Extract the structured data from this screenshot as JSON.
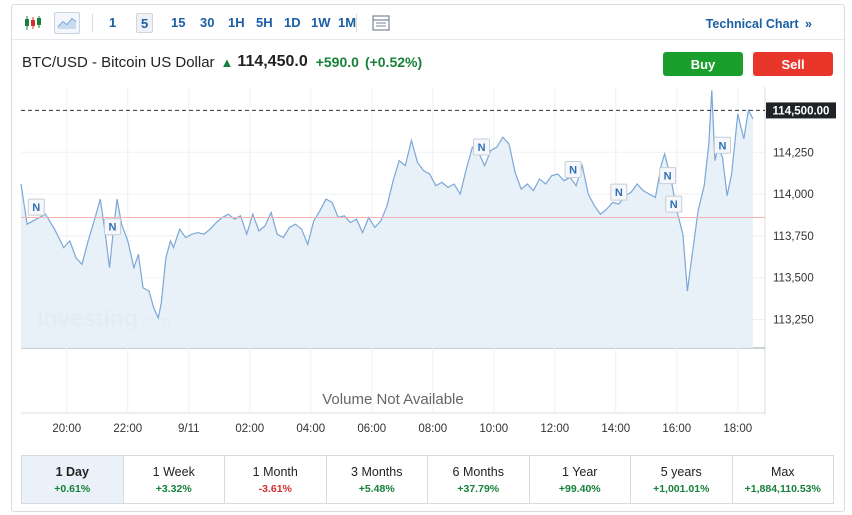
{
  "toolbar": {
    "candles_icon": "candlestick-icon",
    "area_icon": "area-chart-icon",
    "timeframes": [
      "1",
      "5",
      "15",
      "30",
      "1H",
      "5H",
      "1D",
      "1W",
      "1M"
    ],
    "active_timeframe": "5",
    "table_icon": "table-icon",
    "technical_link": "Technical Chart",
    "technical_chevron": "»"
  },
  "header": {
    "name": "BTC/USD - Bitcoin US Dollar",
    "price": "114,450.0",
    "change": "+590.0",
    "change_pct": "(+0.52%)"
  },
  "actions": {
    "buy": "Buy",
    "sell": "Sell"
  },
  "colors": {
    "up": "#16813a",
    "down": "#d32f2f",
    "buy": "#1a9e2c",
    "sell": "#e8362a",
    "line": "#7ca7d8",
    "fill": "#e6eef7",
    "link": "#1b5fa6"
  },
  "watermark": "Investing.com",
  "volume_text": "Volume Not Available",
  "chart_data": {
    "type": "area",
    "x_ticks": [
      "20:00",
      "22:00",
      "9/11",
      "02:00",
      "04:00",
      "06:00",
      "08:00",
      "10:00",
      "12:00",
      "14:00",
      "16:00",
      "18:00"
    ],
    "y_ticks": [
      "114,250",
      "114,000",
      "113,750",
      "113,500",
      "113,250"
    ],
    "y_tick_values": [
      114250,
      114000,
      113750,
      113500,
      113250
    ],
    "ylim": [
      113080,
      114640
    ],
    "current_price_label": "114,500.00",
    "current_price": 114500,
    "reference_line": 113860,
    "news_markers": [
      {
        "label": "N",
        "t": 0.5
      },
      {
        "label": "N",
        "t": 3.0
      },
      {
        "label": "N",
        "t": 15.1
      },
      {
        "label": "N",
        "t": 18.1
      },
      {
        "label": "N",
        "t": 19.6
      },
      {
        "label": "N",
        "t": 21.2
      },
      {
        "label": "N",
        "t": 21.4
      },
      {
        "label": "N",
        "t": 23.0
      }
    ],
    "series": [
      {
        "values": [
          [
            0.0,
            114060
          ],
          [
            0.2,
            113820
          ],
          [
            0.5,
            113850
          ],
          [
            0.8,
            113880
          ],
          [
            1.1,
            113790
          ],
          [
            1.4,
            113680
          ],
          [
            1.6,
            113720
          ],
          [
            1.8,
            113620
          ],
          [
            2.0,
            113580
          ],
          [
            2.2,
            113720
          ],
          [
            2.4,
            113840
          ],
          [
            2.6,
            113970
          ],
          [
            2.75,
            113780
          ],
          [
            2.9,
            113560
          ],
          [
            3.05,
            113820
          ],
          [
            3.15,
            113970
          ],
          [
            3.3,
            113820
          ],
          [
            3.5,
            113720
          ],
          [
            3.7,
            113560
          ],
          [
            3.85,
            113640
          ],
          [
            4.0,
            113440
          ],
          [
            4.2,
            113420
          ],
          [
            4.35,
            113320
          ],
          [
            4.5,
            113260
          ],
          [
            4.6,
            113350
          ],
          [
            4.75,
            113620
          ],
          [
            4.9,
            113720
          ],
          [
            5.0,
            113680
          ],
          [
            5.2,
            113790
          ],
          [
            5.4,
            113740
          ],
          [
            5.6,
            113760
          ],
          [
            5.8,
            113770
          ],
          [
            6.0,
            113760
          ],
          [
            6.2,
            113790
          ],
          [
            6.4,
            113830
          ],
          [
            6.6,
            113860
          ],
          [
            6.8,
            113880
          ],
          [
            7.0,
            113850
          ],
          [
            7.2,
            113870
          ],
          [
            7.4,
            113760
          ],
          [
            7.6,
            113880
          ],
          [
            7.8,
            113780
          ],
          [
            8.0,
            113810
          ],
          [
            8.2,
            113890
          ],
          [
            8.4,
            113760
          ],
          [
            8.6,
            113740
          ],
          [
            8.8,
            113800
          ],
          [
            9.0,
            113820
          ],
          [
            9.2,
            113790
          ],
          [
            9.4,
            113700
          ],
          [
            9.6,
            113840
          ],
          [
            9.8,
            113900
          ],
          [
            10.0,
            113970
          ],
          [
            10.2,
            113950
          ],
          [
            10.4,
            113860
          ],
          [
            10.6,
            113870
          ],
          [
            10.8,
            113830
          ],
          [
            11.0,
            113850
          ],
          [
            11.2,
            113770
          ],
          [
            11.4,
            113860
          ],
          [
            11.6,
            113800
          ],
          [
            11.8,
            113840
          ],
          [
            12.0,
            113930
          ],
          [
            12.2,
            114080
          ],
          [
            12.4,
            114200
          ],
          [
            12.6,
            114170
          ],
          [
            12.8,
            114320
          ],
          [
            13.0,
            114190
          ],
          [
            13.2,
            114140
          ],
          [
            13.4,
            114120
          ],
          [
            13.6,
            114050
          ],
          [
            13.8,
            114070
          ],
          [
            14.0,
            114040
          ],
          [
            14.2,
            114060
          ],
          [
            14.4,
            114000
          ],
          [
            14.6,
            114150
          ],
          [
            14.8,
            114280
          ],
          [
            15.0,
            114250
          ],
          [
            15.2,
            114170
          ],
          [
            15.4,
            114260
          ],
          [
            15.6,
            114280
          ],
          [
            15.8,
            114340
          ],
          [
            16.0,
            114300
          ],
          [
            16.2,
            114130
          ],
          [
            16.4,
            114030
          ],
          [
            16.6,
            114060
          ],
          [
            16.8,
            114020
          ],
          [
            17.0,
            114090
          ],
          [
            17.2,
            114060
          ],
          [
            17.4,
            114110
          ],
          [
            17.6,
            114120
          ],
          [
            17.8,
            114080
          ],
          [
            18.0,
            114100
          ],
          [
            18.2,
            114050
          ],
          [
            18.4,
            114170
          ],
          [
            18.6,
            114000
          ],
          [
            18.8,
            113930
          ],
          [
            19.0,
            113880
          ],
          [
            19.2,
            113910
          ],
          [
            19.4,
            113950
          ],
          [
            19.6,
            113940
          ],
          [
            19.8,
            113990
          ],
          [
            20.0,
            114010
          ],
          [
            20.2,
            114060
          ],
          [
            20.4,
            114020
          ],
          [
            20.6,
            114000
          ],
          [
            20.8,
            113980
          ],
          [
            21.0,
            114180
          ],
          [
            21.1,
            114240
          ],
          [
            21.3,
            114100
          ],
          [
            21.5,
            113900
          ],
          [
            21.7,
            113760
          ],
          [
            21.85,
            113420
          ],
          [
            22.0,
            113630
          ],
          [
            22.2,
            113900
          ],
          [
            22.4,
            114050
          ],
          [
            22.55,
            114300
          ],
          [
            22.65,
            114620
          ],
          [
            22.75,
            114200
          ],
          [
            22.85,
            114280
          ],
          [
            23.0,
            114220
          ],
          [
            23.15,
            113990
          ],
          [
            23.3,
            114120
          ],
          [
            23.5,
            114480
          ],
          [
            23.7,
            114330
          ],
          [
            23.85,
            114500
          ],
          [
            24.0,
            114450
          ]
        ]
      }
    ]
  },
  "periods": [
    {
      "label": "1 Day",
      "value": "+0.61%",
      "dir": "up",
      "active": true
    },
    {
      "label": "1 Week",
      "value": "+3.32%",
      "dir": "up",
      "active": false
    },
    {
      "label": "1 Month",
      "value": "-3.61%",
      "dir": "down",
      "active": false
    },
    {
      "label": "3 Months",
      "value": "+5.48%",
      "dir": "up",
      "active": false
    },
    {
      "label": "6 Months",
      "value": "+37.79%",
      "dir": "up",
      "active": false
    },
    {
      "label": "1 Year",
      "value": "+99.40%",
      "dir": "up",
      "active": false
    },
    {
      "label": "5 years",
      "value": "+1,001.01%",
      "dir": "up",
      "active": false
    },
    {
      "label": "Max",
      "value": "+1,884,110.53%",
      "dir": "up",
      "active": false
    }
  ]
}
